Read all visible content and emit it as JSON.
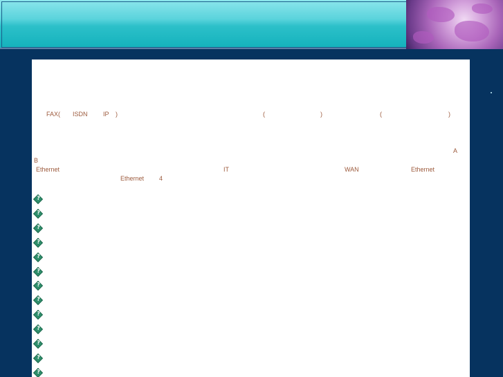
{
  "intro_line": {
    "fax": "FAX(",
    "isdn": "ISDN",
    "ip": "IP",
    "close_paren": ")",
    "open_paren_1": "(",
    "close_paren_1": ")",
    "open_paren_2": "(",
    "close_paren_2": ")"
  },
  "paragraph": {
    "a": "A",
    "b": "B",
    "ethernet_1": "Ethernet",
    "it": "IT",
    "wan": "WAN",
    "ethernet_2": "Ethernet",
    "ethernet_3": "Ethernet",
    "four": "4"
  },
  "bullet_count": 13,
  "colors": {
    "page_bg": "#06335f",
    "text": "#9c5a3c",
    "bullet": "#2f8f6c"
  },
  "icons": [
    "globe-image",
    "bullet-icon"
  ]
}
